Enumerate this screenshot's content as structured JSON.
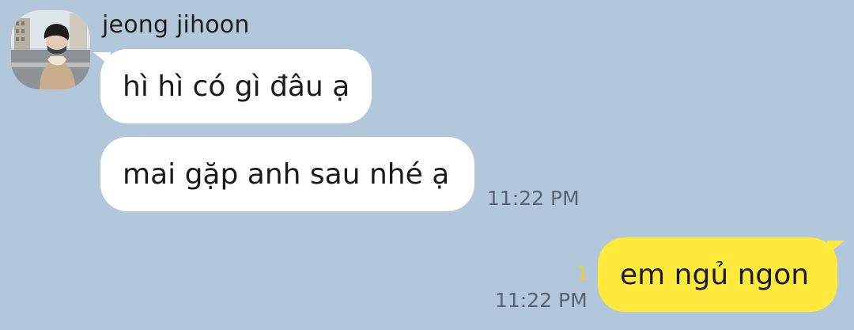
{
  "chat": {
    "sender": {
      "name": "jeong jihoon",
      "avatar_icon": "profile-photo"
    },
    "incoming": [
      {
        "text": "hì hì có gì đâu ạ"
      },
      {
        "text": "mai gặp anh sau nhé ạ",
        "time": "11:22 PM"
      }
    ],
    "outgoing": [
      {
        "text": "em ngủ ngon",
        "time": "11:22 PM",
        "unread_count": "1"
      }
    ]
  },
  "colors": {
    "background": "#b2c7da",
    "incoming_bubble": "#ffffff",
    "outgoing_bubble": "#fee93c",
    "unread": "#e9d230",
    "timestamp": "#556372"
  }
}
